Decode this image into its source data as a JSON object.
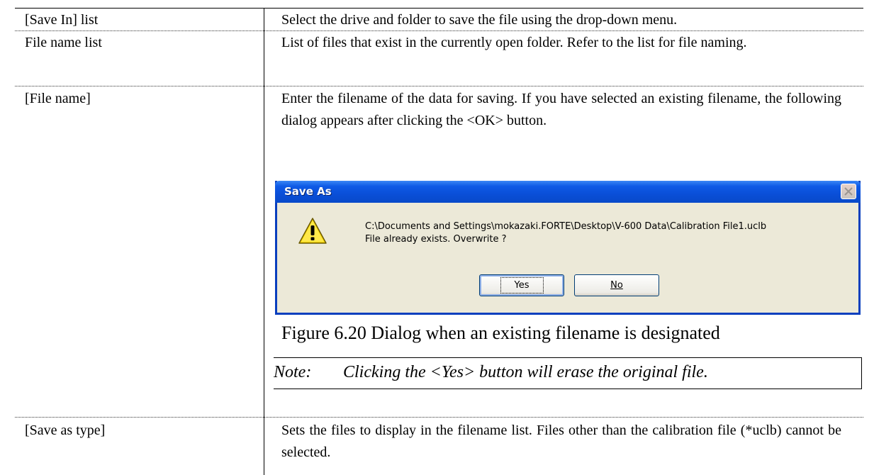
{
  "rows": [
    {
      "label": "[Save In] list",
      "desc": "Select the drive and folder to save the file using the drop-down menu."
    },
    {
      "label": "File name list",
      "desc": "List of files that exist in the currently open folder. Refer to the list for file naming."
    },
    {
      "label": "[File name]",
      "desc": "Enter the filename of the data for saving. If you have selected an existing filename, the following dialog appears after clicking the <OK> button."
    },
    {
      "label": "[Save as type]",
      "desc": "Sets the files to display in the filename list. Files other than the calibration file (*uclb) cannot be selected."
    }
  ],
  "dialog": {
    "title": "Save As",
    "message_path": "C:\\Documents and Settings\\mokazaki.FORTE\\Desktop\\V-600 Data\\Calibration File1.uclb",
    "message_question": "File already exists. Overwrite ?",
    "yes_label": "Yes",
    "no_label": "No",
    "icon": "warning-icon",
    "colors": {
      "title_bar": "#0a4fd8",
      "body": "#ece9d8"
    }
  },
  "caption": "Figure 6.20 Dialog when an existing filename is designated",
  "note": {
    "head": "Note:",
    "body": "Clicking the <Yes> button will erase the original file."
  }
}
